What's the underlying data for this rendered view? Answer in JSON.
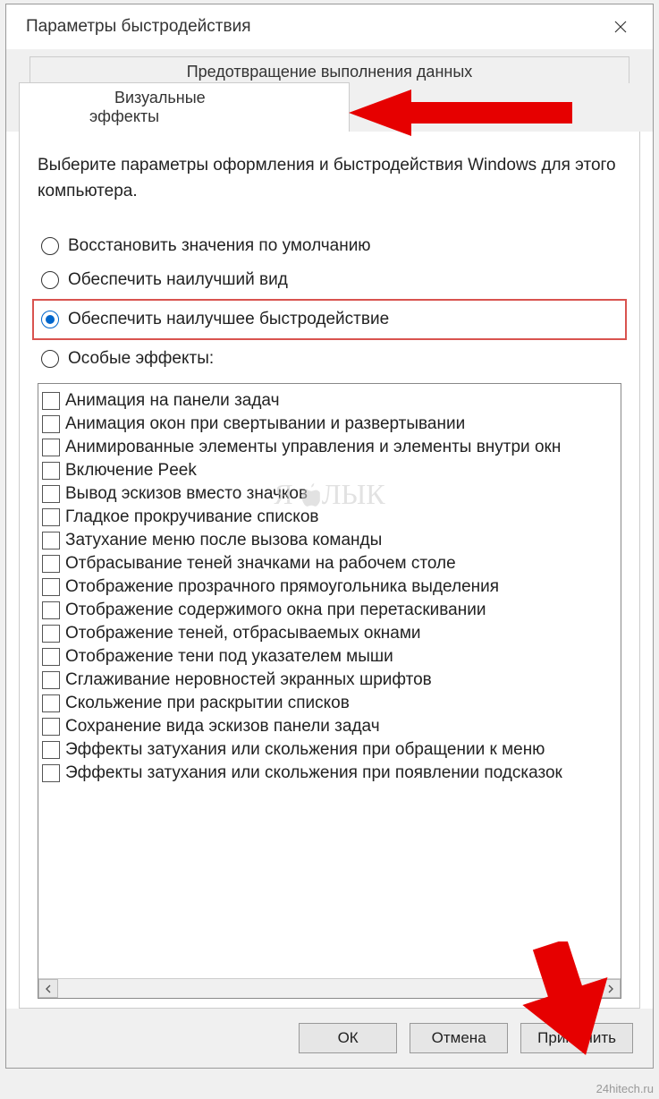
{
  "window": {
    "title": "Параметры быстродействия"
  },
  "tabs": {
    "back": "Предотвращение выполнения данных",
    "front": "Визуальные эффекты"
  },
  "intro": "Выберите параметры оформления и быстродействия Windows для этого компьютера.",
  "radios": {
    "restore": "Восстановить значения по умолчанию",
    "best_appearance": "Обеспечить наилучший вид",
    "best_performance": "Обеспечить наилучшее быстродействие",
    "custom": "Особые эффекты:"
  },
  "effects": [
    "Анимация на панели задач",
    "Анимация окон при свертывании и развертывании",
    "Анимированные элементы управления и элементы внутри окн",
    "Включение Peek",
    "Вывод эскизов вместо значков",
    "Гладкое прокручивание списков",
    "Затухание меню после вызова команды",
    "Отбрасывание теней значками на рабочем столе",
    "Отображение прозрачного прямоугольника выделения",
    "Отображение содержимого окна при перетаскивании",
    "Отображение теней, отбрасываемых окнами",
    "Отображение тени под указателем мыши",
    "Сглаживание неровностей экранных шрифтов",
    "Скольжение при раскрытии списков",
    "Сохранение вида эскизов панели задач",
    "Эффекты затухания или скольжения при обращении к меню",
    "Эффекты затухания или скольжения при появлении подсказок"
  ],
  "buttons": {
    "ok": "ОК",
    "cancel": "Отмена",
    "apply": "Применить"
  },
  "watermark": {
    "left": "Я",
    "right": "ЛЫК"
  },
  "source": "24hitech.ru",
  "colors": {
    "highlight_border": "#d9534f",
    "arrow": "#e60000"
  }
}
